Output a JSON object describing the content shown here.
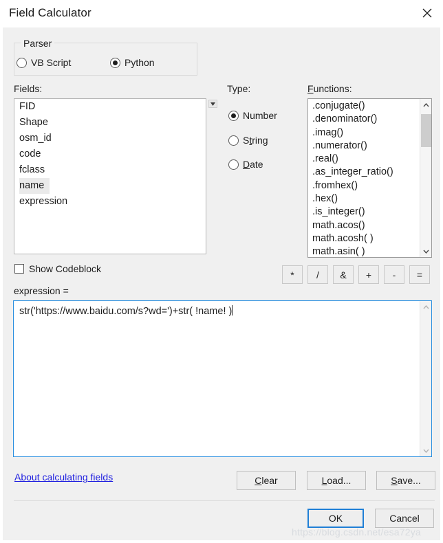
{
  "window": {
    "title": "Field Calculator",
    "close_icon": "close-icon"
  },
  "parser": {
    "legend": "Parser",
    "options": [
      {
        "label": "VB Script",
        "selected": false
      },
      {
        "label": "Python",
        "selected": true
      }
    ]
  },
  "labels": {
    "fields": "Fields:",
    "type": "Type:",
    "functions": "Functions:",
    "expression": "expression ="
  },
  "fields": {
    "items": [
      {
        "label": "FID",
        "selected": false
      },
      {
        "label": "Shape",
        "selected": false
      },
      {
        "label": "osm_id",
        "selected": false
      },
      {
        "label": "code",
        "selected": false
      },
      {
        "label": "fclass",
        "selected": false
      },
      {
        "label": "name",
        "selected": true
      },
      {
        "label": "expression",
        "selected": false
      }
    ],
    "scroll_button_icon": "scroll-down-icon"
  },
  "type": {
    "options": [
      {
        "label": "Number",
        "selected": true
      },
      {
        "label": "String",
        "selected": false
      },
      {
        "label": "Date",
        "selected": false
      }
    ]
  },
  "functions": {
    "items": [
      ".conjugate()",
      ".denominator()",
      ".imag()",
      ".numerator()",
      ".real()",
      ".as_integer_ratio()",
      ".fromhex()",
      ".hex()",
      ".is_integer()",
      "math.acos()",
      "math.acosh( )",
      "math.asin( )"
    ],
    "scrollbar": {
      "up_icon": "chevron-up-icon",
      "down_icon": "chevron-down-icon"
    }
  },
  "codeblock": {
    "label": "Show Codeblock",
    "checked": false
  },
  "operators": [
    "*",
    "/",
    "&",
    "+",
    "-",
    "="
  ],
  "expression": {
    "value": "str('https://www.baidu.com/s?wd=')+str( !name! )"
  },
  "footer": {
    "about_link": "About calculating fields",
    "clear_label": "Clear",
    "load_label": "Load...",
    "save_label": "Save...",
    "ok_label": "OK",
    "cancel_label": "Cancel"
  },
  "watermark": {
    "text": "https://blog.csdn.net/esa72ya"
  },
  "colors": {
    "accent": "#2a8fe0",
    "link": "#2020e0",
    "dialog_bg": "#f0f0f0",
    "selection": "#eaeaea"
  }
}
